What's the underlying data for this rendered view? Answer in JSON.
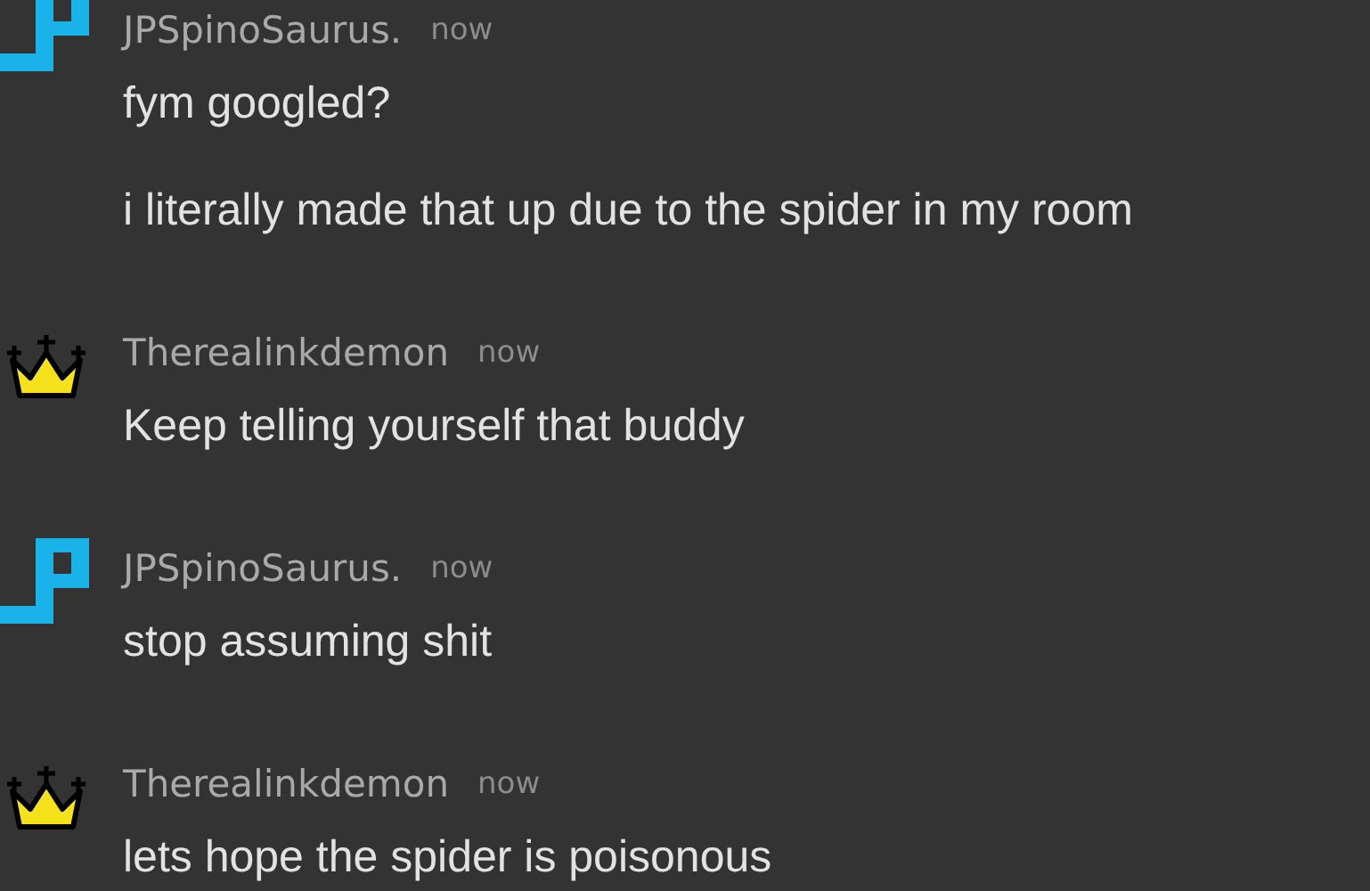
{
  "messages": [
    {
      "author": "JPSpinoSaurus.",
      "kind": "pixel",
      "time": "now",
      "lines": [
        "fym googled?",
        "i literally made that up due to the spider in my room"
      ]
    },
    {
      "author": "Therealinkdemon",
      "kind": "crown",
      "time": "now",
      "lines": [
        "Keep telling yourself that buddy"
      ]
    },
    {
      "author": "JPSpinoSaurus.",
      "kind": "pixel",
      "time": "now",
      "lines": [
        "stop assuming shit"
      ]
    },
    {
      "author": "Therealinkdemon",
      "kind": "crown",
      "time": "now",
      "lines": [
        "lets hope the spider is poisonous"
      ]
    }
  ]
}
